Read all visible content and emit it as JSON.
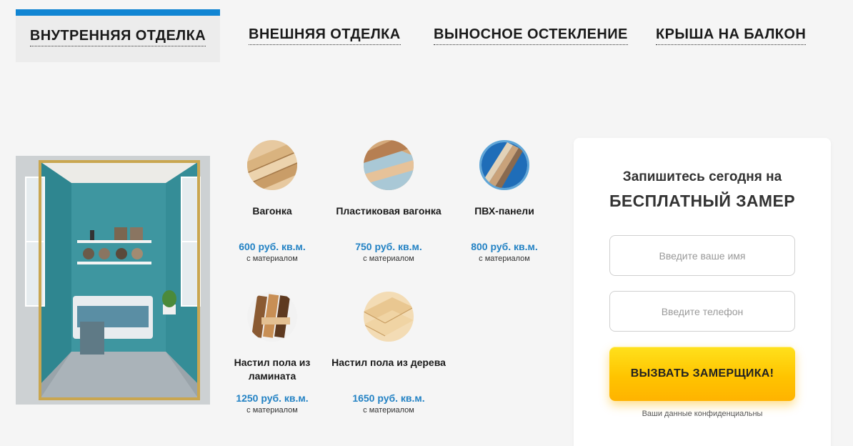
{
  "colors": {
    "accent": "#1185d3",
    "price": "#2382c4",
    "cta": "#ffc400"
  },
  "tabs": [
    {
      "label": "ВНУТРЕННЯЯ ОТДЕЛКА",
      "active": true
    },
    {
      "label": "ВНЕШНЯЯ ОТДЕЛКА",
      "active": false
    },
    {
      "label": "ВЫНОСНОЕ ОСТЕКЛЕНИЕ",
      "active": false
    },
    {
      "label": "КРЫША НА БАЛКОН",
      "active": false
    }
  ],
  "products": [
    {
      "name": "Вагонка",
      "price": "600 руб. кв.м.",
      "note": "с материалом",
      "icon": "wood-lining-icon"
    },
    {
      "name": "Пластиковая вагонка",
      "price": "750 руб. кв.м.",
      "note": "с материалом",
      "icon": "plastic-lining-icon"
    },
    {
      "name": "ПВХ-панели",
      "price": "800 руб. кв.м.",
      "note": "с материалом",
      "icon": "pvc-panels-icon"
    },
    {
      "name": "Настил пола из ламината",
      "price": "1250 руб. кв.м.",
      "note": "с материалом",
      "icon": "laminate-icon"
    },
    {
      "name": "Настил пола из дерева",
      "price": "1650 руб. кв.м.",
      "note": "с материалом",
      "icon": "wood-floor-icon"
    }
  ],
  "form": {
    "title": "Запишитесь сегодня на",
    "subtitle": "БЕСПЛАТНЫЙ ЗАМЕР",
    "name_placeholder": "Введите ваше имя",
    "phone_placeholder": "Введите телефон",
    "submit_label": "ВЫЗВАТЬ ЗАМЕРЩИКА!",
    "privacy": "Ваши данные конфиденциальны"
  }
}
